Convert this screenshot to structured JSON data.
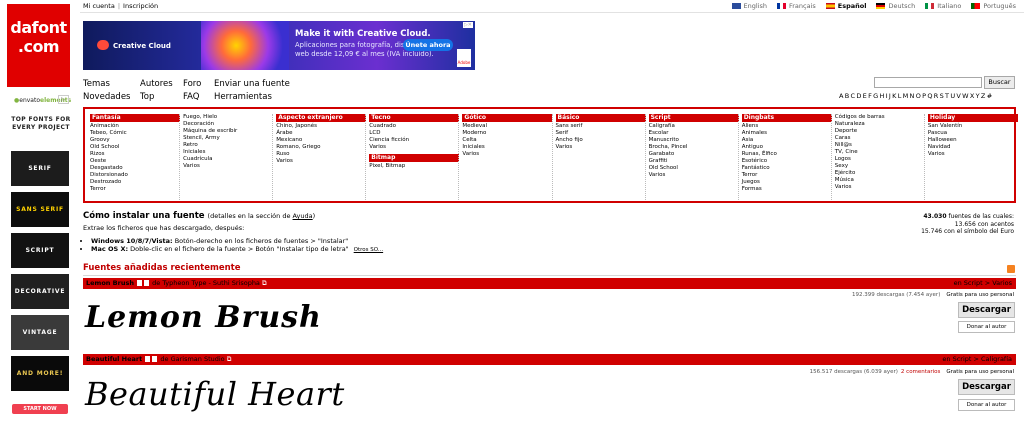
{
  "logo": {
    "line1": "dafont",
    "line2": ".com"
  },
  "envato": {
    "brand_prefix": "envato",
    "brand_suffix": "elements"
  },
  "top_fonts_label": "TOP FONTS FOR EVERY PROJECT",
  "tiles": [
    "SERIF",
    "SANS SERIF",
    "SCRIPT",
    "DECORATIVE",
    "VINTAGE",
    "AND MORE!"
  ],
  "start_now": "START NOW",
  "account": {
    "my_account": "Mi cuenta",
    "register": "Inscripción"
  },
  "languages": [
    {
      "label": "English",
      "active": false
    },
    {
      "label": "Français",
      "active": false
    },
    {
      "label": "Español",
      "active": true
    },
    {
      "label": "Deutsch",
      "active": false
    },
    {
      "label": "Italiano",
      "active": false
    },
    {
      "label": "Português",
      "active": false
    }
  ],
  "banner": {
    "product": "Creative Cloud",
    "headline": "Make it with Creative Cloud.",
    "subtext": "Aplicaciones para fotografía, diseño, vídeo y web desde 12,09 € al mes (IVA incluido).",
    "cta": "Únete ahora",
    "brand": "Adobe"
  },
  "nav": {
    "col1": [
      "Temas",
      "Novedades"
    ],
    "col2": [
      "Autores",
      "Top"
    ],
    "col3": [
      "Foro",
      "FAQ"
    ],
    "col4": [
      "Enviar una fuente",
      "Herramientas"
    ]
  },
  "search": {
    "value": "",
    "button": "Buscar"
  },
  "alphabet": [
    "A",
    "B",
    "C",
    "D",
    "E",
    "F",
    "G",
    "H",
    "I",
    "J",
    "K",
    "L",
    "M",
    "N",
    "O",
    "P",
    "Q",
    "R",
    "S",
    "T",
    "U",
    "V",
    "W",
    "X",
    "Y",
    "Z",
    "#"
  ],
  "categories": [
    {
      "title": "Fantasía",
      "items": [
        "Animación",
        "Tebeo, Cómic",
        "Groovy",
        "Old School",
        "Rizos",
        "Oeste",
        "Desgastado",
        "Distorsionado",
        "Destrozado",
        "Terror"
      ]
    },
    {
      "title": "",
      "items": [
        "Fuego, Hielo",
        "Decoración",
        "Máquina de escribir",
        "Stencil, Army",
        "Retro",
        "Iniciales",
        "Cuadrícula",
        "Varios"
      ]
    },
    {
      "title": "Aspecto extranjero",
      "items": [
        "Chino, Japonés",
        "Árabe",
        "Mexicano",
        "Romano, Griego",
        "Ruso",
        "Varios"
      ]
    },
    {
      "title": "Tecno",
      "items": [
        "Cuadrado",
        "LCD",
        "Ciencia ficción",
        "Varios"
      ],
      "title2": "Bitmap",
      "items2": [
        "Pixel, Bitmap"
      ]
    },
    {
      "title": "Gótico",
      "items": [
        "Medieval",
        "Moderno",
        "Celta",
        "Iniciales",
        "Varios"
      ]
    },
    {
      "title": "Básico",
      "items": [
        "Sans serif",
        "Serif",
        "Ancho fijo",
        "Varios"
      ]
    },
    {
      "title": "Script",
      "items": [
        "Caligrafía",
        "Escolar",
        "Manuscrito",
        "Brocha, Pincel",
        "Garabato",
        "Graffiti",
        "Old School",
        "Varios"
      ]
    },
    {
      "title": "Dingbats",
      "items": [
        "Aliens",
        "Animales",
        "Asia",
        "Antiguo",
        "Runas, Élfico",
        "Esotérico",
        "Fantástico",
        "Terror",
        "Juegos",
        "Formas"
      ]
    },
    {
      "title": "",
      "items": [
        "Códigos de barras",
        "Naturaleza",
        "Deporte",
        "Caras",
        "Nill@s",
        "TV, Cine",
        "Logos",
        "Sexy",
        "Ejército",
        "Música",
        "Varios"
      ]
    },
    {
      "title": "Holiday",
      "items": [
        "San Valentín",
        "Pascua",
        "Halloween",
        "Navidad",
        "Varios"
      ]
    }
  ],
  "install": {
    "title": "Cómo instalar una fuente",
    "detail_prefix": "(detalles en la sección de",
    "detail_link": "Ayuda",
    "detail_suffix": ")",
    "subtitle": "Extrae los ficheros que has descargado, después:",
    "win_label": "Windows 10/8/7/Vista:",
    "win_text": "Botón-derecho en los ficheros de fuentes > \"Instalar\"",
    "mac_label": "Mac OS X:",
    "mac_text": "Doble-clic en el fichero de la fuente > Botón \"Instalar tipo de letra\"",
    "other": "Otros SO..."
  },
  "stats": {
    "count": "43.030",
    "line1_suffix": "fuentes de las cuales:",
    "line2": "13.656 con acentos",
    "line3": "15.746 con el símbolo del Euro"
  },
  "recent_title": "Fuentes añadidas recientemente",
  "fonts": [
    {
      "name": "Lemon Brush",
      "by": "de Typheon Type - Suthi Srisopha",
      "category": "en Script > Varios",
      "downloads": "192.399 descargas (7.454 ayer)",
      "comments": "",
      "license": "Gratis para uso personal",
      "preview": "Lemon Brush",
      "download_label": "Descargar",
      "donate_label": "Donar al autor"
    },
    {
      "name": "Beautiful Heart",
      "by": "de Garisman Studio",
      "category": "en Script > Caligrafía",
      "downloads": "156.517 descargas (6.039 ayer)",
      "comments": "2 comentarios",
      "license": "Gratis para uso personal",
      "preview": "Beautiful Heart",
      "download_label": "Descargar",
      "donate_label": "Donar al autor"
    }
  ]
}
